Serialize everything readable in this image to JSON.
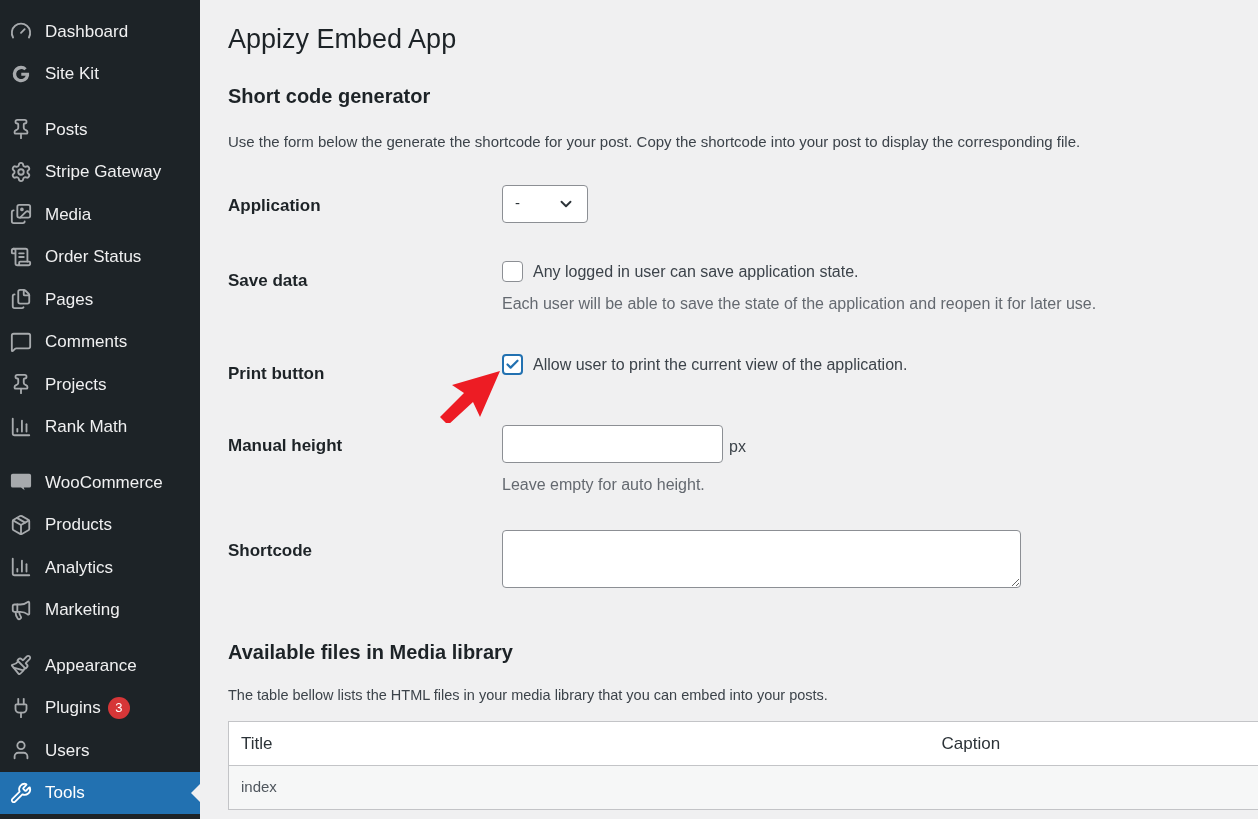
{
  "sidebar": {
    "groups": [
      {
        "items": [
          {
            "label": "Dashboard",
            "selected": false
          },
          {
            "label": "Site Kit",
            "selected": false
          }
        ]
      },
      {
        "items": [
          {
            "label": "Posts",
            "selected": false
          },
          {
            "label": "Stripe Gateway",
            "selected": false
          },
          {
            "label": "Media",
            "selected": false
          },
          {
            "label": "Order Status",
            "selected": false
          },
          {
            "label": "Pages",
            "selected": false
          },
          {
            "label": "Comments",
            "selected": false
          },
          {
            "label": "Projects",
            "selected": false
          },
          {
            "label": "Rank Math",
            "selected": false
          }
        ]
      },
      {
        "items": [
          {
            "label": "WooCommerce",
            "selected": false
          },
          {
            "label": "Products",
            "selected": false
          },
          {
            "label": "Analytics",
            "selected": false
          },
          {
            "label": "Marketing",
            "selected": false
          }
        ]
      },
      {
        "items": [
          {
            "label": "Appearance",
            "selected": false
          },
          {
            "label": "Plugins",
            "selected": false,
            "badge": "3"
          },
          {
            "label": "Users",
            "selected": false
          },
          {
            "label": "Tools",
            "selected": true
          }
        ]
      }
    ]
  },
  "page": {
    "title": "Appizy Embed App",
    "generator": {
      "heading": "Short code generator",
      "description": "Use the form below the generate the shortcode for your post. Copy the shortcode into your post to display the corresponding file.",
      "fields": [
        {
          "kind": "select",
          "label": "Application",
          "value": "-"
        },
        {
          "kind": "checkbox",
          "label": "Save data",
          "option": "Any logged in user can save application state.",
          "checked": false,
          "hint": "Each user will be able to save the state of the application and reopen it for later use."
        },
        {
          "kind": "checkbox",
          "label": "Print button",
          "option": "Allow user to print the current view of the application.",
          "checked": true,
          "pointer": true
        },
        {
          "kind": "text",
          "label": "Manual height",
          "unit": "px",
          "hint": "Leave empty for auto height."
        },
        {
          "kind": "textarea",
          "label": "Shortcode"
        }
      ]
    },
    "files": {
      "heading": "Available files in Media library",
      "description": "The table bellow lists the HTML files in your media library that you can embed into your posts.",
      "table": {
        "columns": [
          "Title",
          "Caption"
        ],
        "rows": [
          [
            "index",
            ""
          ]
        ]
      }
    }
  }
}
